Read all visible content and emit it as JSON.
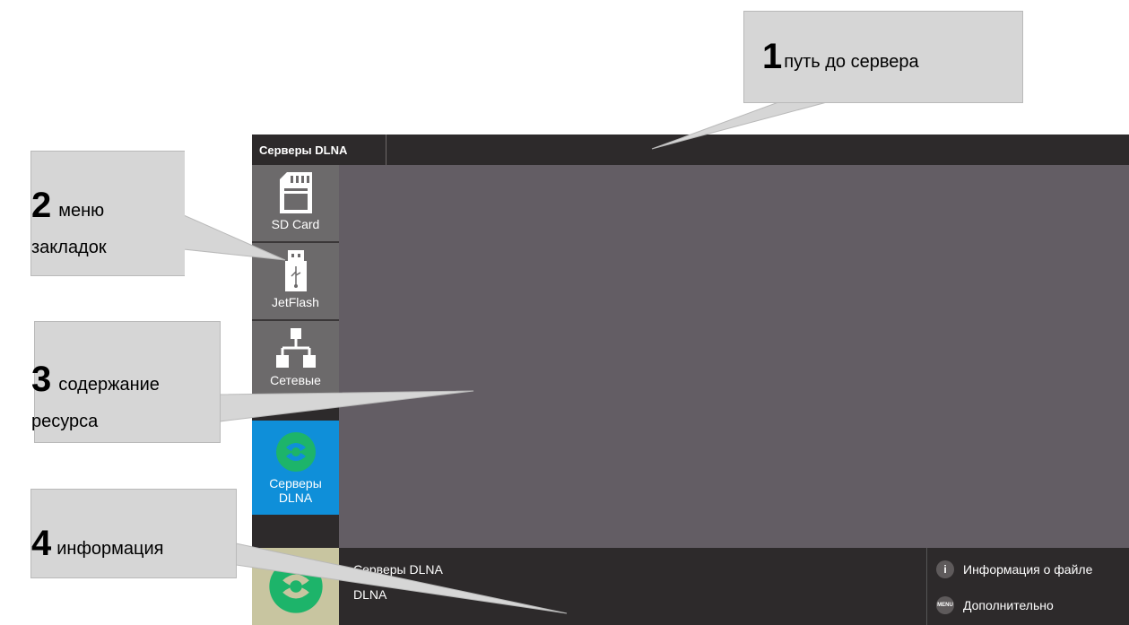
{
  "app": {
    "tab_title": "Серверы DLNA",
    "sidebar": [
      {
        "label": "SD Card",
        "icon": "sd-card-icon"
      },
      {
        "label": "JetFlash",
        "icon": "usb-icon"
      },
      {
        "label": "Сетевые",
        "icon": "network-icon"
      },
      {
        "label": "Серверы DLNA",
        "icon": "dlna-icon"
      }
    ],
    "info": {
      "line1": "Серверы DLNA",
      "line2": "DLNA",
      "actions": [
        {
          "label": "Информация о файле",
          "icon": "info-icon"
        },
        {
          "label": "Дополнительно",
          "icon": "menu-icon",
          "icon_text": "MENU"
        }
      ]
    }
  },
  "callouts": [
    {
      "number": "1",
      "text": "путь до сервера"
    },
    {
      "number": "2",
      "text": "меню",
      "text2": "закладок"
    },
    {
      "number": "3",
      "text": "содержание",
      "text2": "ресурса"
    },
    {
      "number": "4",
      "text": "информация"
    }
  ],
  "colors": {
    "sidebar_active": "#0f8fd9",
    "content_bg": "#635d64",
    "callout_bg": "#d6d6d6"
  }
}
